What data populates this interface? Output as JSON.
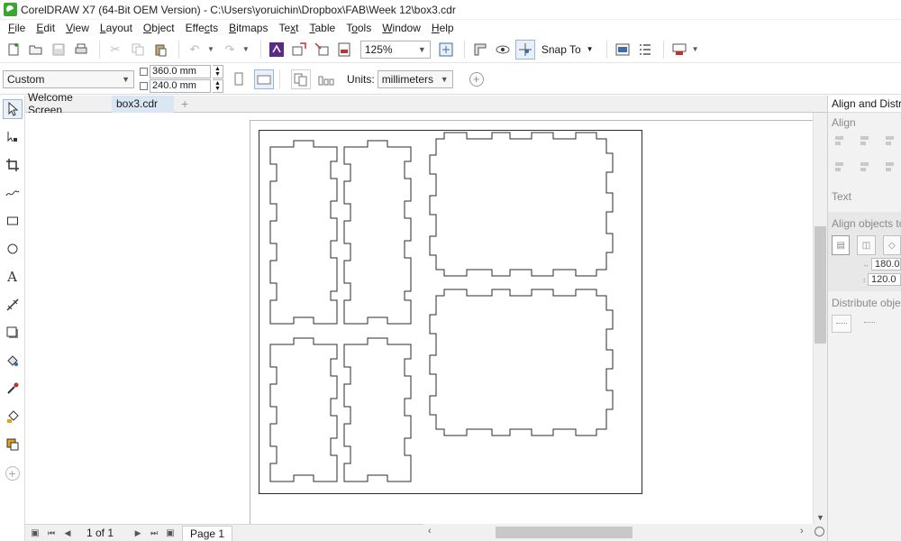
{
  "window": {
    "title": "CorelDRAW X7 (64-Bit OEM Version) - C:\\Users\\yoruichin\\Dropbox\\FAB\\Week 12\\box3.cdr"
  },
  "menu": [
    {
      "label": "File",
      "mn": "F",
      "rest": "ile"
    },
    {
      "label": "Edit",
      "mn": "E",
      "rest": "dit"
    },
    {
      "label": "View",
      "mn": "V",
      "rest": "iew"
    },
    {
      "label": "Layout",
      "mn": "L",
      "rest": "ayout"
    },
    {
      "label": "Object",
      "mn": "O",
      "rest": "bject"
    },
    {
      "label": "Effects",
      "mn": "",
      "pre": "Effe",
      "mid": "c",
      "rest": "ts"
    },
    {
      "label": "Bitmaps",
      "mn": "B",
      "rest": "itmaps"
    },
    {
      "label": "Text",
      "mn": "",
      "pre": "Te",
      "mid": "x",
      "rest": "t"
    },
    {
      "label": "Table",
      "mn": "T",
      "rest": "able"
    },
    {
      "label": "Tools",
      "mn": "",
      "pre": "T",
      "mid": "o",
      "rest": "ols"
    },
    {
      "label": "Window",
      "mn": "W",
      "rest": "indow"
    },
    {
      "label": "Help",
      "mn": "H",
      "rest": "elp"
    }
  ],
  "toolbar": {
    "zoom": "125%",
    "snap_label": "Snap To"
  },
  "propbar": {
    "preset": "Custom",
    "width": "360.0 mm",
    "height": "240.0 mm",
    "units_label": "Units:",
    "units_value": "millimeters"
  },
  "tabs": {
    "welcome": "Welcome Screen",
    "document": "box3.cdr"
  },
  "status": {
    "page_count": "1 of 1",
    "page_tab": "Page 1"
  },
  "docker": {
    "title": "Align and Distribute",
    "align_heading": "Align",
    "text_heading": "Text",
    "align_to_heading": "Align objects to",
    "x_value": "180.0",
    "y_value": "120.0",
    "distribute_heading": "Distribute objects"
  },
  "colors": {
    "accent": "#d9e7f5",
    "logo": "#3aa62f",
    "outline": "#2b2b2b"
  }
}
